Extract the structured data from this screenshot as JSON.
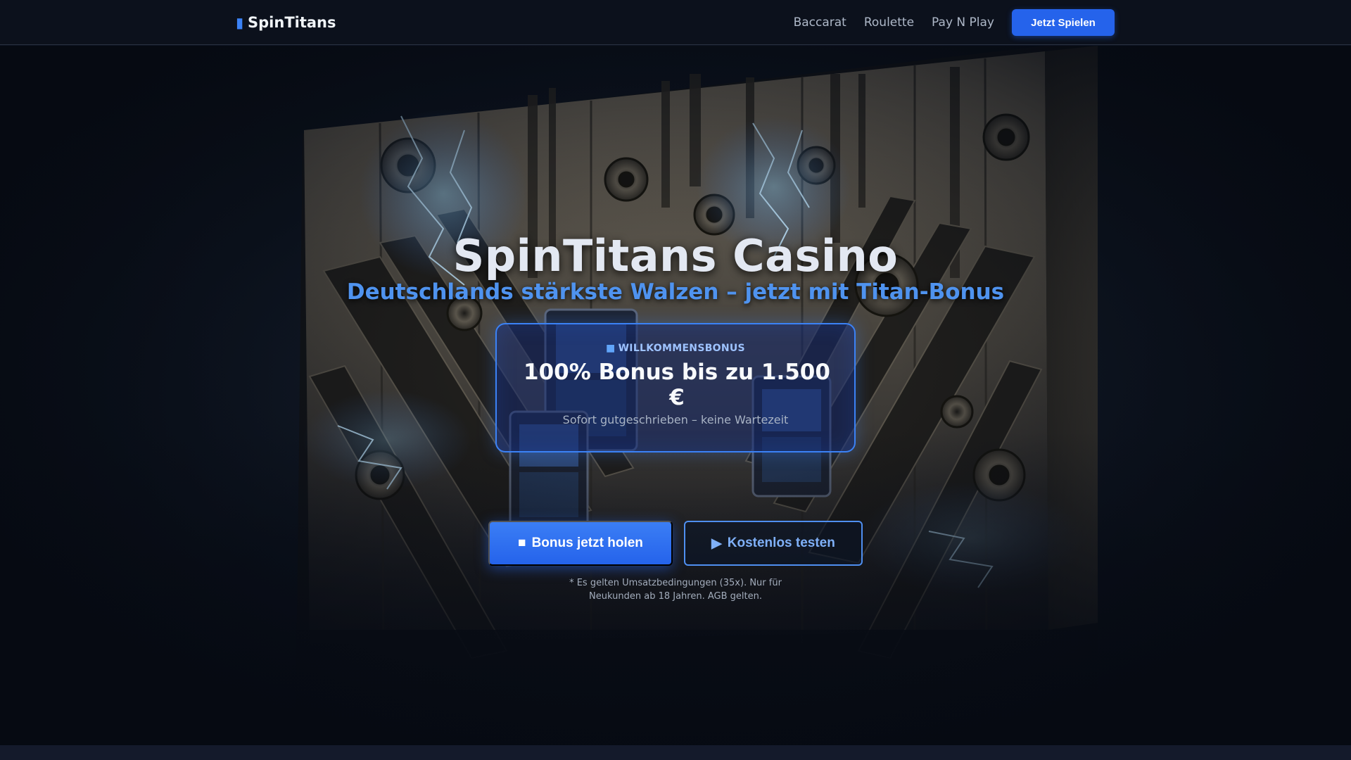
{
  "navbar": {
    "brand_icon": "slot-icon",
    "brand_name": "SpinTitans",
    "links": [
      {
        "label": "Baccarat"
      },
      {
        "label": "Roulette"
      },
      {
        "label": "Pay N Play"
      }
    ],
    "cta_label": "Jetzt Spielen"
  },
  "hero": {
    "title": "SpinTitans Casino",
    "subtitle": "Deutschlands stärkste Walzen – jetzt mit Titan-Bonus",
    "bonus_card": {
      "kicker_icon": "gift-icon",
      "kicker": "WILLKOMMENSBONUS",
      "amount": "100% Bonus bis zu 1.500 €",
      "note": "Sofort gutgeschrieben – keine Wartezeit"
    },
    "primary_button": {
      "icon": "gift-icon",
      "label": "Bonus jetzt holen"
    },
    "secondary_button": {
      "icon": "play-icon",
      "label": "Kostenlos testen"
    },
    "fine_print": "* Es gelten Umsatzbedingungen (35x). Nur für Neukunden ab 18 Jahren. AGB gelten."
  },
  "colors": {
    "accent": "#2563eb",
    "subtitle": "#4f93ef",
    "background": "#0b1120"
  }
}
